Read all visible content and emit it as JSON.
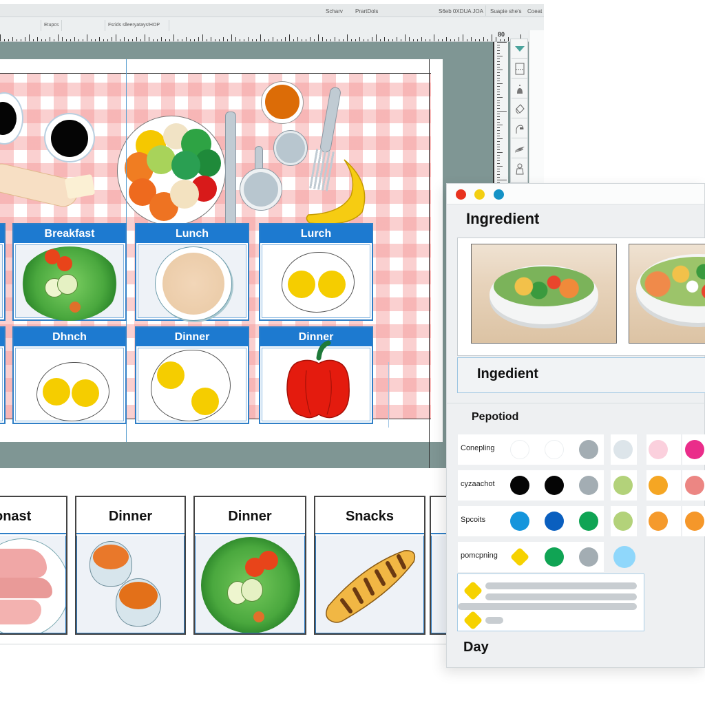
{
  "editor": {
    "menubar": {
      "items": [
        "Scharv",
        "PrartDols",
        "S6eb 0XDUA JOA",
        "Suapie she's",
        "Coeat"
      ]
    },
    "tabs": [
      "Etupcs",
      "Fsrids slleeryatays!HOP"
    ],
    "ruler_label": "80",
    "tools": [
      "dropdown-arrow",
      "layout-panel",
      "fill-bucket",
      "eraser",
      "pen",
      "brush",
      "hand"
    ]
  },
  "artboard": {
    "meal_cards": [
      {
        "label": "Breakfast",
        "food": "salad"
      },
      {
        "label": "Lunch",
        "food": "rice-bowl"
      },
      {
        "label": "Lurch",
        "food": "eggs"
      },
      {
        "label": "Dhnch",
        "food": "eggs"
      },
      {
        "label": "Dinner",
        "food": "eggs"
      },
      {
        "label": "Dinner",
        "food": "bell-pepper"
      }
    ],
    "tablecloth_items": [
      "coffee-cup",
      "coffee-cup",
      "bread-stick",
      "vegetable-plate",
      "knife",
      "sauce-bowl",
      "frying-pan",
      "small-bowl",
      "fork",
      "banana"
    ]
  },
  "strip": {
    "cards": [
      {
        "label": "onast",
        "food": "ham"
      },
      {
        "label": "Dinner",
        "food": "soup"
      },
      {
        "label": "Dinner",
        "food": "salad"
      },
      {
        "label": "Snacks",
        "food": "baguette"
      }
    ]
  },
  "ingredient_window": {
    "title": "Ingredient",
    "subtitle": "Ingedient",
    "section": "Pepotiod",
    "footer": "Day",
    "window_dots": [
      "#e8321e",
      "#f3cf12",
      "#1492c6"
    ],
    "photos": [
      "salad-bowl-photo-1",
      "salad-bowl-photo-2"
    ],
    "swatch_rows": [
      {
        "label": "Conepling",
        "colors": [
          "#ffffff",
          "#ffffff",
          "#a3adb3",
          "#dde5ea",
          "#fbd0dd",
          "#ea2d8a"
        ]
      },
      {
        "label": "cyzaachot",
        "colors": [
          "#050505",
          "#050505",
          "#a3adb3",
          "#b3d27a",
          "#f5a623",
          "#ec8683"
        ]
      },
      {
        "label": "Spcoits",
        "colors": [
          "#1595dc",
          "#0a5fbf",
          "#10a454",
          "#b3d27a",
          "#f59a2c",
          "#f5972a"
        ]
      },
      {
        "label": "pomcpning",
        "colors": [
          "#f6d200",
          "#10a454",
          "#a3adb3",
          "#8fd7fb"
        ]
      }
    ],
    "list_items": [
      {
        "icon": "diamond",
        "lines": 2
      },
      {
        "icon": "diamond",
        "lines": 1
      }
    ]
  }
}
